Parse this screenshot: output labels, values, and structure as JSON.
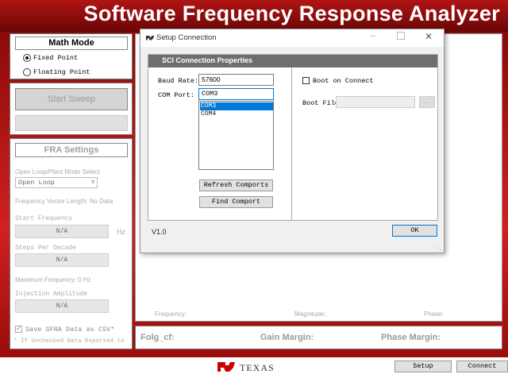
{
  "app": {
    "title": "Software Frequency Response Analyzer"
  },
  "math_mode": {
    "title": "Math Mode",
    "options": [
      "Fixed Point",
      "Floating Point"
    ],
    "selected": "Fixed Point"
  },
  "sweep": {
    "start_label": "Start Sweep",
    "status": ""
  },
  "fra_settings": {
    "title": "FRA Settings",
    "loop_mode_label": "Open Loop/Plant Mode Select",
    "loop_mode_value": "Open Loop",
    "freq_vector_label": "Frequency Vector Length: No Data",
    "start_freq_label": "Start Frequency",
    "start_freq_value": "N/A",
    "start_freq_unit": "Hz",
    "steps_label": "Steps Per Decade",
    "steps_value": "N/A",
    "max_freq_label": "Maximum Frequency: 0 Hz",
    "injection_label": "Injection Amplitude",
    "injection_value": "N/A",
    "save_csv_label": "Save SFRA Data as CSV*",
    "save_csv_checked": true,
    "footnote": "* If Unchecked Data Exported to"
  },
  "plot": {
    "freq_label": "Frequency:",
    "mag_label": "Magnitude:",
    "phase_label": "Phase:"
  },
  "results": {
    "folg_label": "Folg_cf:",
    "gain_label": "Gain Margin:",
    "phase_label": "Phase Margin:"
  },
  "footer": {
    "logo_text": "TEXAS",
    "setup_label": "Setup",
    "connect_label": "Connect"
  },
  "dialog": {
    "title": "Setup Connection",
    "section_title": "SCI Connection Properties",
    "baud_label": "Baud Rate:",
    "baud_value": "57600",
    "com_label": "COM Port:",
    "com_value": "COM3",
    "com_options": [
      "COM3",
      "COM4"
    ],
    "com_selected": "COM3",
    "refresh_label": "Refresh Comports",
    "find_label": "Find Comport",
    "boot_connect_label": "Boot on Connect",
    "boot_connect_checked": false,
    "boot_file_label": "Boot File:",
    "boot_file_value": "",
    "browse_label": "...",
    "version": "V1.0",
    "ok_label": "OK"
  },
  "colors": {
    "banner": "#8a0a0a",
    "section_header": "#6e6e6e",
    "selection": "#0078d7"
  }
}
